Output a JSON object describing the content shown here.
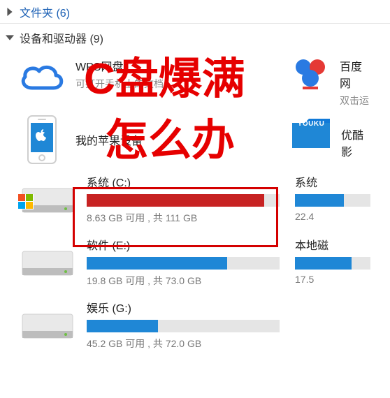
{
  "sections": {
    "folders": {
      "label": "文件夹 (6)"
    },
    "devices": {
      "label": "设备和驱动器 (9)"
    }
  },
  "items": {
    "wps": {
      "title": "WPS网盘",
      "subtitle": "可打开手机上的文档"
    },
    "baidu": {
      "title": "百度网",
      "subtitle": "双击运"
    },
    "iphone": {
      "title": "我的苹果设备"
    },
    "youku": {
      "badge": "YOUKU",
      "title": "优酷影"
    }
  },
  "drives": {
    "c": {
      "name": "系统 (C:)",
      "status": "8.63 GB 可用 , 共 111 GB",
      "free_gb": 8.63,
      "total_gb": 111,
      "used_pct": 92,
      "color": "red",
      "is_windows": true
    },
    "right1": {
      "name": "系统",
      "status": "22.4",
      "used_pct": 65,
      "color": "blue"
    },
    "e": {
      "name": "软件 (E:)",
      "status": "19.8 GB 可用 , 共 73.0 GB",
      "free_gb": 19.8,
      "total_gb": 73.0,
      "used_pct": 73,
      "color": "blue"
    },
    "right2": {
      "name": "本地磁",
      "status": "17.5",
      "used_pct": 75,
      "color": "blue"
    },
    "g": {
      "name": "娱乐 (G:)",
      "status": "45.2 GB 可用 , 共 72.0 GB",
      "free_gb": 45.2,
      "total_gb": 72.0,
      "used_pct": 37,
      "color": "blue"
    }
  },
  "overlay": {
    "line1": "C盘爆满",
    "line2": "怎么办"
  },
  "colors": {
    "accent_blue": "#1f87d6",
    "danger_red": "#c72222",
    "overlay_red": "#e60000"
  }
}
